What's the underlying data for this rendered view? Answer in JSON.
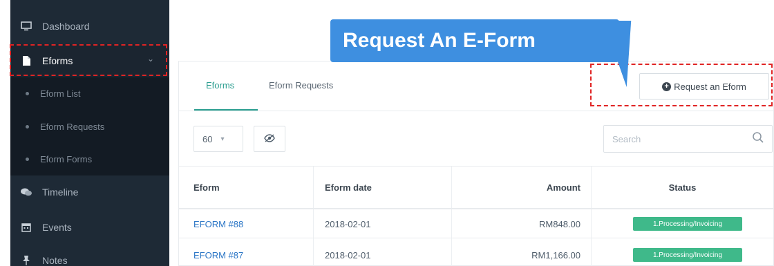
{
  "sidebar": {
    "items": [
      {
        "label": "Dashboard",
        "icon": "monitor-icon"
      },
      {
        "label": "Eforms",
        "icon": "file-icon"
      },
      {
        "label": "Timeline",
        "icon": "chat-icon"
      },
      {
        "label": "Events",
        "icon": "calendar-icon"
      },
      {
        "label": "Notes",
        "icon": "pin-icon"
      }
    ],
    "subitems": [
      "Eform List",
      "Eform Requests",
      "Eform Forms"
    ]
  },
  "tooltip": {
    "text": "Request An E-Form"
  },
  "tabs": [
    {
      "label": "Eforms"
    },
    {
      "label": "Eform Requests"
    }
  ],
  "request_button": {
    "label": "Request an Eform"
  },
  "page_size": {
    "value": "60"
  },
  "search": {
    "placeholder": "Search"
  },
  "table": {
    "headers": [
      "Eform",
      "Eform date",
      "Amount",
      "Status"
    ],
    "rows": [
      {
        "eform": "EFORM #88",
        "date": "2018-02-01",
        "amount": "RM848.00",
        "status": "1.Processing/Invoicing"
      },
      {
        "eform": "EFORM #87",
        "date": "2018-02-01",
        "amount": "RM1,166.00",
        "status": "1.Processing/Invoicing"
      }
    ]
  },
  "colors": {
    "sidebar_bg": "#1e2a36",
    "accent": "#2a9d8f",
    "tooltip": "#3e8fe0",
    "highlight": "#e02424",
    "status_badge": "#3fb98a",
    "link": "#2b76c6"
  }
}
